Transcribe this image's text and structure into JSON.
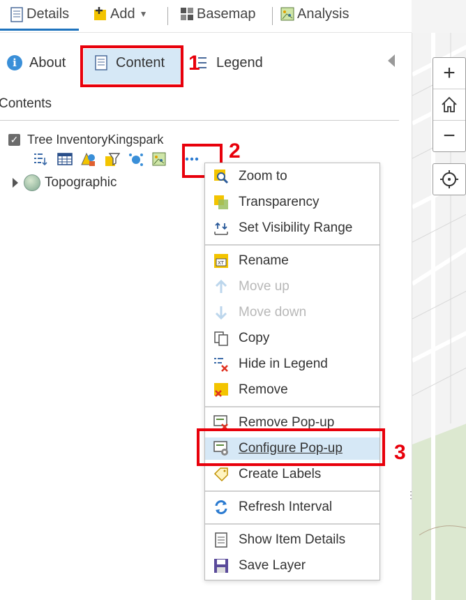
{
  "toolbar": {
    "details": "Details",
    "add": "Add",
    "basemap": "Basemap",
    "analysis": "Analysis"
  },
  "tabs": {
    "about": "About",
    "content": "Content",
    "legend": "Legend"
  },
  "contents_label": "Contents",
  "layers": {
    "tree": "Tree InventoryKingspark",
    "topographic": "Topographic"
  },
  "menu": {
    "zoom_to": "Zoom to",
    "transparency": "Transparency",
    "set_visibility_range": "Set Visibility Range",
    "rename": "Rename",
    "move_up": "Move up",
    "move_down": "Move down",
    "copy": "Copy",
    "hide_in_legend": "Hide in Legend",
    "remove": "Remove",
    "remove_popup": "Remove Pop-up",
    "configure_popup": "Configure Pop-up",
    "create_labels": "Create Labels",
    "refresh_interval": "Refresh Interval",
    "show_item_details": "Show Item Details",
    "save_layer": "Save Layer"
  },
  "annotations": {
    "n1": "1",
    "n2": "2",
    "n3": "3"
  },
  "map_controls": {
    "zoom_in": "+",
    "zoom_out": "−"
  },
  "colors": {
    "accent": "#1e73be",
    "highlight": "#e8000b",
    "selected_bg": "#d6e8f6"
  }
}
